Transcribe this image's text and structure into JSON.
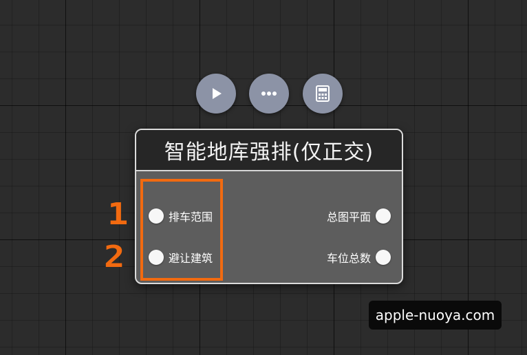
{
  "toolbar": {
    "buttons": [
      {
        "icon": "play-icon"
      },
      {
        "icon": "more-icon"
      },
      {
        "icon": "calculator-icon"
      }
    ]
  },
  "node": {
    "title": "智能地库强排(仅正交)",
    "inputs": [
      {
        "label": "排车范围"
      },
      {
        "label": "避让建筑"
      }
    ],
    "outputs": [
      {
        "label": "总图平面"
      },
      {
        "label": "车位总数"
      }
    ]
  },
  "annotations": {
    "markers": [
      "1",
      "2"
    ],
    "highlight_color": "#f26a10"
  },
  "watermark": {
    "text": "apple-nuoya.com"
  },
  "colors": {
    "canvas": "#2c2c2c",
    "node_body": "#5d5d5d",
    "node_header": "#262626",
    "toolbar_button": "#8c93a6"
  }
}
